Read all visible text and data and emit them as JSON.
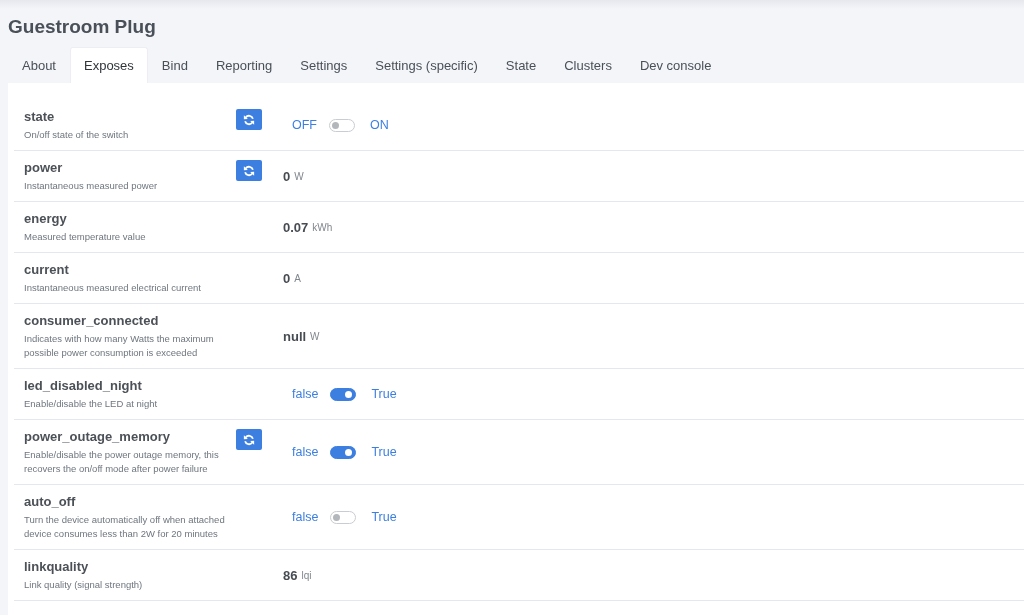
{
  "page": {
    "title": "Guestroom Plug"
  },
  "tabs": [
    {
      "label": "About",
      "selected": false
    },
    {
      "label": "Exposes",
      "selected": true
    },
    {
      "label": "Bind",
      "selected": false
    },
    {
      "label": "Reporting",
      "selected": false
    },
    {
      "label": "Settings",
      "selected": false
    },
    {
      "label": "Settings (specific)",
      "selected": false
    },
    {
      "label": "State",
      "selected": false
    },
    {
      "label": "Clusters",
      "selected": false
    },
    {
      "label": "Dev console",
      "selected": false
    }
  ],
  "exposes": [
    {
      "name": "state",
      "description": "On/off state of the switch",
      "refresh": true,
      "kind": "binary",
      "off_label": "OFF",
      "on_label": "ON",
      "on": false
    },
    {
      "name": "power",
      "description": "Instantaneous measured power",
      "refresh": true,
      "kind": "numeric",
      "value": "0",
      "unit": "W"
    },
    {
      "name": "energy",
      "description": "Measured temperature value",
      "refresh": false,
      "kind": "numeric",
      "value": "0.07",
      "unit": "kWh"
    },
    {
      "name": "current",
      "description": "Instantaneous measured electrical current",
      "refresh": false,
      "kind": "numeric",
      "value": "0",
      "unit": "A"
    },
    {
      "name": "consumer_connected",
      "description": "Indicates with how many Watts the maximum possible power consumption is exceeded",
      "refresh": false,
      "kind": "numeric",
      "value": "null",
      "unit": "W"
    },
    {
      "name": "led_disabled_night",
      "description": "Enable/disable the LED at night",
      "refresh": false,
      "kind": "binary",
      "off_label": "false",
      "on_label": "True",
      "on": true
    },
    {
      "name": "power_outage_memory",
      "description": "Enable/disable the power outage memory, this recovers the on/off mode after power failure",
      "refresh": true,
      "kind": "binary",
      "off_label": "false",
      "on_label": "True",
      "on": true
    },
    {
      "name": "auto_off",
      "description": "Turn the device automatically off when attached device consumes less than 2W for 20 minutes",
      "refresh": false,
      "kind": "binary",
      "off_label": "false",
      "on_label": "True",
      "on": false
    },
    {
      "name": "linkquality",
      "description": "Link quality (signal strength)",
      "refresh": false,
      "kind": "numeric",
      "value": "86",
      "unit": "lqi"
    }
  ]
}
